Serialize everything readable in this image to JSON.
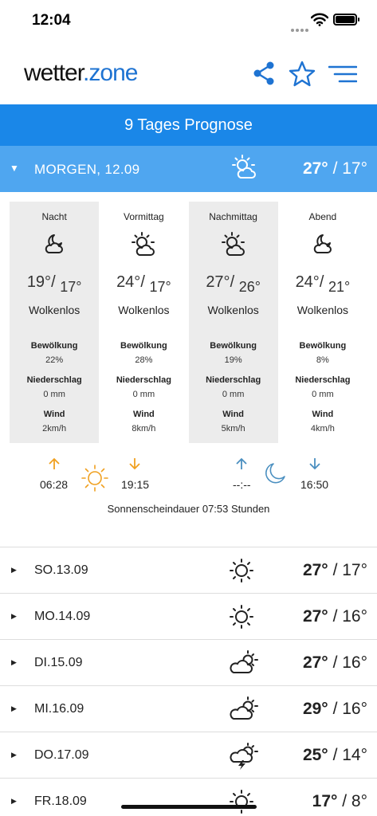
{
  "status": {
    "time": "12:04"
  },
  "header": {
    "logo_part1": "wetter",
    "logo_dot": ".",
    "logo_part2": "zone"
  },
  "title": "9 Tages Prognose",
  "colors": {
    "brand": "#1e73d2",
    "band": "#1a87e8",
    "selected_day": "#4fa6f0",
    "sun_arrow": "#f0a020",
    "moon_arrow": "#4a8fc0"
  },
  "selected_day": {
    "label": "MORGEN, 12.09",
    "icon": "sun-cloud-icon",
    "high": "27°",
    "low": "/ 17°"
  },
  "periods": [
    {
      "name": "Nacht",
      "icon": "moon-cloud-icon",
      "high": "19°",
      "low": "17°",
      "desc": "Wolkenlos",
      "cloud_label": "Bewölkung",
      "cloud": "22%",
      "rain_label": "Niederschlag",
      "rain": "0 mm",
      "wind_label": "Wind",
      "wind": "2km/h"
    },
    {
      "name": "Vormittag",
      "icon": "sun-cloud-icon",
      "high": "24°",
      "low": "17°",
      "desc": "Wolkenlos",
      "cloud_label": "Bewölkung",
      "cloud": "28%",
      "rain_label": "Niederschlag",
      "rain": "0 mm",
      "wind_label": "Wind",
      "wind": "8km/h"
    },
    {
      "name": "Nachmittag",
      "icon": "sun-cloud-icon",
      "high": "27°",
      "low": "26°",
      "desc": "Wolkenlos",
      "cloud_label": "Bewölkung",
      "cloud": "19%",
      "rain_label": "Niederschlag",
      "rain": "0 mm",
      "wind_label": "Wind",
      "wind": "5km/h"
    },
    {
      "name": "Abend",
      "icon": "moon-cloud-icon",
      "high": "24°",
      "low": "21°",
      "desc": "Wolkenlos",
      "cloud_label": "Bewölkung",
      "cloud": "8%",
      "rain_label": "Niederschlag",
      "rain": "0 mm",
      "wind_label": "Wind",
      "wind": "4km/h"
    }
  ],
  "sun": {
    "sunrise": "06:28",
    "sunset": "19:15",
    "moonrise": "--:--",
    "moonset": "16:50"
  },
  "sunshine": "Sonnenscheindauer 07:53 Stunden",
  "days": [
    {
      "label": "SO.13.09",
      "icon": "sun-icon",
      "high": "27°",
      "low": "/ 17°"
    },
    {
      "label": "MO.14.09",
      "icon": "sun-icon",
      "high": "27°",
      "low": "/ 16°"
    },
    {
      "label": "DI.15.09",
      "icon": "cloud-sun-icon",
      "high": "27°",
      "low": "/ 16°"
    },
    {
      "label": "MI.16.09",
      "icon": "cloud-sun-icon",
      "high": "29°",
      "low": "/ 16°"
    },
    {
      "label": "DO.17.09",
      "icon": "thunder-cloud-icon",
      "high": "25°",
      "low": "/ 14°"
    },
    {
      "label": "FR.18.09",
      "icon": "sun-icon",
      "high": "17°",
      "low": "/ 8°"
    }
  ]
}
